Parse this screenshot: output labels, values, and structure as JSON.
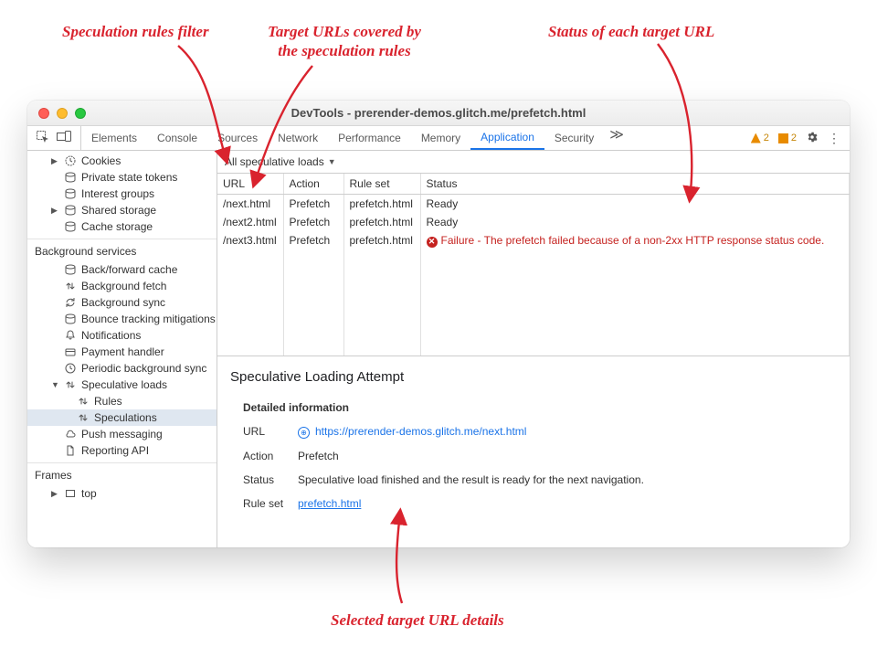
{
  "annotations": {
    "filter": "Speculation rules filter",
    "targets": "Target URLs covered by\nthe speculation rules",
    "status": "Status of each target URL",
    "details": "Selected target URL details"
  },
  "window": {
    "title": "DevTools - prerender-demos.glitch.me/prefetch.html"
  },
  "toolbar": {
    "tabs": [
      "Elements",
      "Console",
      "Sources",
      "Network",
      "Performance",
      "Memory",
      "Application",
      "Security"
    ],
    "active_tab": "Application",
    "more": "≫",
    "warn_count": "2",
    "info_count": "2"
  },
  "sidebar": {
    "storage": [
      {
        "label": "Cookies",
        "icon": "clock",
        "arrow": true
      },
      {
        "label": "Private state tokens",
        "icon": "db"
      },
      {
        "label": "Interest groups",
        "icon": "db"
      },
      {
        "label": "Shared storage",
        "icon": "db",
        "arrow": true
      },
      {
        "label": "Cache storage",
        "icon": "db"
      }
    ],
    "bg_header": "Background services",
    "bg": [
      {
        "label": "Back/forward cache",
        "icon": "db"
      },
      {
        "label": "Background fetch",
        "icon": "updown"
      },
      {
        "label": "Background sync",
        "icon": "sync"
      },
      {
        "label": "Bounce tracking mitigations",
        "icon": "db"
      },
      {
        "label": "Notifications",
        "icon": "bell"
      },
      {
        "label": "Payment handler",
        "icon": "card"
      },
      {
        "label": "Periodic background sync",
        "icon": "clock2"
      },
      {
        "label": "Speculative loads",
        "icon": "updown",
        "arrow": true,
        "expanded": true,
        "children": [
          {
            "label": "Rules",
            "icon": "updown"
          },
          {
            "label": "Speculations",
            "icon": "updown",
            "selected": true
          }
        ]
      },
      {
        "label": "Push messaging",
        "icon": "cloud"
      },
      {
        "label": "Reporting API",
        "icon": "doc"
      }
    ],
    "frames_header": "Frames",
    "frames": [
      {
        "label": "top",
        "icon": "frame",
        "arrow": true
      }
    ]
  },
  "filter": {
    "label": "All speculative loads"
  },
  "table": {
    "headers": {
      "url": "URL",
      "action": "Action",
      "ruleset": "Rule set",
      "status": "Status"
    },
    "rows": [
      {
        "url": "/next.html",
        "action": "Prefetch",
        "ruleset": "prefetch.html",
        "status": "Ready",
        "fail": false
      },
      {
        "url": "/next2.html",
        "action": "Prefetch",
        "ruleset": "prefetch.html",
        "status": "Ready",
        "fail": false
      },
      {
        "url": "/next3.html",
        "action": "Prefetch",
        "ruleset": "prefetch.html",
        "status": "Failure - The prefetch failed because of a non-2xx HTTP response status code.",
        "fail": true
      }
    ]
  },
  "detail": {
    "heading": "Speculative Loading Attempt",
    "sub": "Detailed information",
    "url_label": "URL",
    "url": "https://prerender-demos.glitch.me/next.html",
    "action_label": "Action",
    "action": "Prefetch",
    "status_label": "Status",
    "status": "Speculative load finished and the result is ready for the next navigation.",
    "ruleset_label": "Rule set",
    "ruleset": "prefetch.html"
  }
}
